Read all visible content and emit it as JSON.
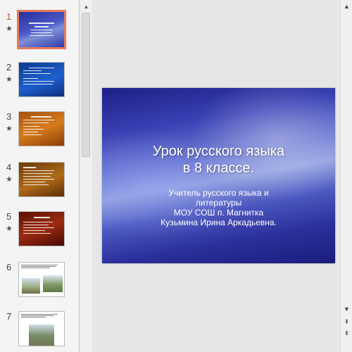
{
  "thumbnails": [
    {
      "number": "1",
      "star": "★",
      "active": true,
      "style": "t1"
    },
    {
      "number": "2",
      "star": "★",
      "active": false,
      "style": "t2"
    },
    {
      "number": "3",
      "star": "★",
      "active": false,
      "style": "t3"
    },
    {
      "number": "4",
      "star": "★",
      "active": false,
      "style": "t4"
    },
    {
      "number": "5",
      "star": "★",
      "active": false,
      "style": "t5"
    },
    {
      "number": "6",
      "star": "",
      "active": false,
      "style": "t6"
    },
    {
      "number": "7",
      "star": "",
      "active": false,
      "style": "t7"
    }
  ],
  "slide": {
    "title_line1": "Урок русского языка",
    "title_line2": "в 8 классе.",
    "subtitle_line1": "Учитель русского языка и",
    "subtitle_line2": "литературы",
    "subtitle_line3": "МОУ СОШ  п. Магнитка",
    "subtitle_line4": "Кузьмина Ирина Аркадьевна."
  },
  "scroll": {
    "up_arrow": "▲",
    "down_arrow": "▼",
    "prev_slide": "⇞",
    "next_slide": "⇟"
  }
}
